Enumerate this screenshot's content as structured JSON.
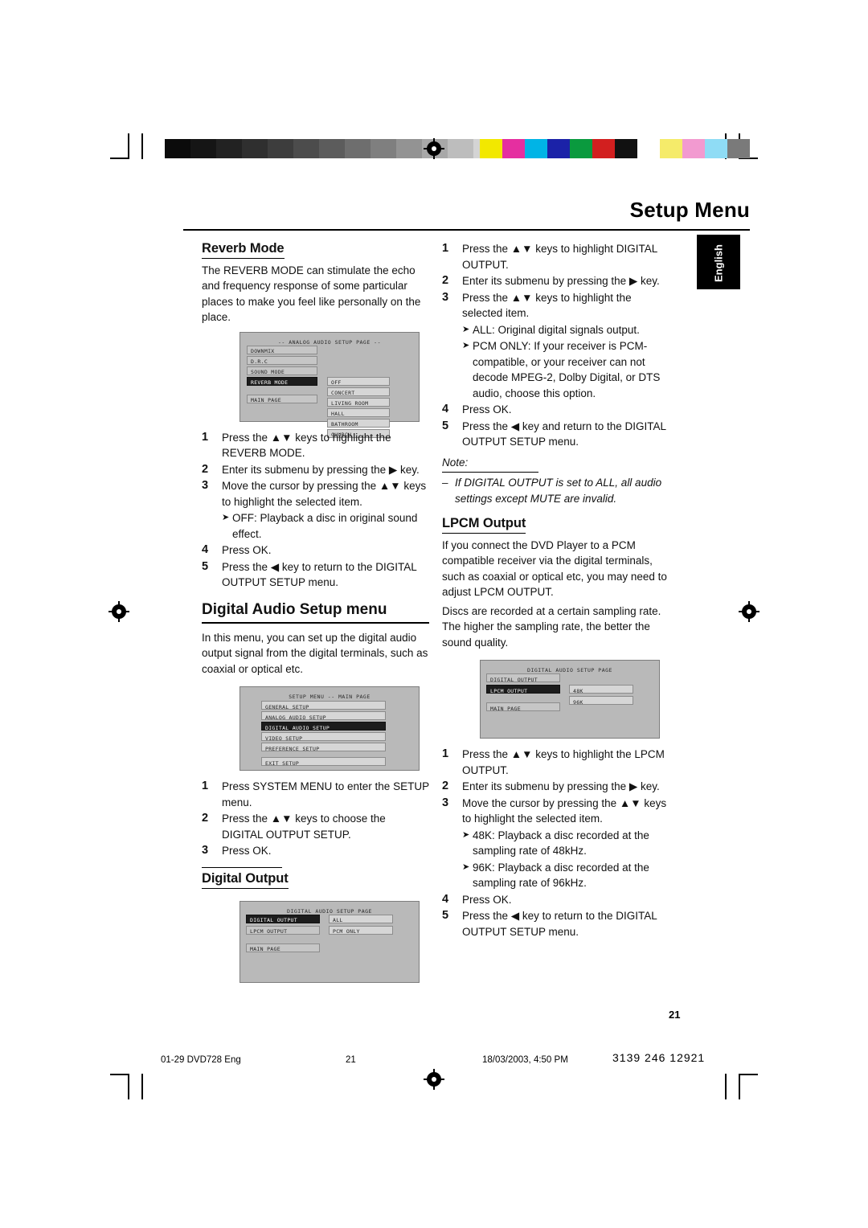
{
  "header": {
    "title": "Setup Menu",
    "language_tab": "English"
  },
  "print_marks": {
    "grayscale": [
      "#0b0b0b",
      "#151515",
      "#222222",
      "#2f2f2f",
      "#3d3d3d",
      "#4c4c4c",
      "#5c5c5c",
      "#6e6e6e",
      "#7f7f7f",
      "#939393",
      "#a8a8a8",
      "#bdbdbd",
      "#d4d4d4",
      "#ececec",
      "#ffffff"
    ],
    "colorbar": [
      "#f2e800",
      "#e52fa0",
      "#00b4e6",
      "#1b22a8",
      "#0a9a3e",
      "#d21f1f",
      "#111111",
      "#ffffff",
      "#f5eb6a",
      "#f29ad0",
      "#8fdcf5",
      "#7a7a7a"
    ]
  },
  "left_column": {
    "reverb": {
      "heading": "Reverb Mode",
      "paragraph": "The REVERB MODE can stimulate the echo and frequency response of some particular places to make you feel like personally on the place.",
      "osd": {
        "title": "-- ANALOG AUDIO SETUP PAGE --",
        "menu_items": [
          "DOWNMIX",
          "D.R.C",
          "SOUND MODE",
          "REVERB MODE",
          "MAIN PAGE"
        ],
        "selected_item": "REVERB MODE",
        "options": [
          "OFF",
          "CONCERT",
          "LIVING ROOM",
          "HALL",
          "BATHROOM",
          "CHURCH"
        ],
        "highlighted_option": "OFF"
      },
      "steps": [
        {
          "n": "1",
          "text": "Press the ▲▼ keys to highlight the REVERB MODE."
        },
        {
          "n": "2",
          "text": "Enter its submenu by pressing the ▶ key."
        },
        {
          "n": "3",
          "text": "Move the cursor by pressing the ▲▼ keys to highlight the selected item."
        }
      ],
      "bullet": "OFF: Playback a disc in original sound effect.",
      "steps2": [
        {
          "n": "4",
          "text": "Press OK."
        },
        {
          "n": "5",
          "text": "Press the ◀ key to return to the DIGITAL OUTPUT SETUP menu."
        }
      ]
    },
    "digital_audio_setup": {
      "heading": "Digital Audio Setup menu",
      "paragraph": "In this menu, you can set up the digital audio output signal from the digital terminals, such as coaxial or optical etc.",
      "osd": {
        "title": "SETUP MENU -- MAIN PAGE",
        "menu_items": [
          "GENERAL SETUP",
          "ANALOG AUDIO SETUP",
          "DIGITAL AUDIO SETUP",
          "VIDEO SETUP",
          "PREFERENCE SETUP",
          "EXIT SETUP"
        ],
        "selected_item": "DIGITAL AUDIO SETUP"
      },
      "steps": [
        {
          "n": "1",
          "text": "Press SYSTEM MENU to enter the SETUP menu."
        },
        {
          "n": "2",
          "text": "Press the ▲▼ keys to choose the DIGITAL OUTPUT SETUP."
        },
        {
          "n": "3",
          "text": "Press OK."
        }
      ]
    },
    "digital_output": {
      "heading": "Digital Output",
      "osd": {
        "title": "DIGITAL AUDIO SETUP PAGE",
        "menu_items": [
          "DIGITAL OUTPUT",
          "LPCM OUTPUT",
          "MAIN PAGE"
        ],
        "selected_item": "DIGITAL OUTPUT",
        "options": [
          "ALL",
          "PCM ONLY"
        ],
        "highlighted_option": "ALL"
      }
    }
  },
  "right_column": {
    "digital_output_steps": [
      {
        "n": "1",
        "text": "Press the ▲▼ keys to highlight DIGITAL OUTPUT."
      },
      {
        "n": "2",
        "text": "Enter its submenu by pressing the ▶ key."
      },
      {
        "n": "3",
        "text": "Press the ▲▼ keys to highlight the selected item."
      }
    ],
    "bullets": [
      "ALL: Original digital signals output.",
      "PCM ONLY: If your receiver is PCM-compatible, or your receiver can not decode MPEG-2, Dolby Digital, or DTS audio, choose this option."
    ],
    "digital_output_steps2": [
      {
        "n": "4",
        "text": "Press OK."
      },
      {
        "n": "5",
        "text": "Press the ◀ key and return to the DIGITAL OUTPUT SETUP menu."
      }
    ],
    "note": {
      "label": "Note:",
      "text": "If DIGITAL OUTPUT is set to ALL, all audio settings except MUTE are invalid."
    },
    "lpcm": {
      "heading": "LPCM Output",
      "paragraphs": [
        "If you connect the DVD Player to a PCM compatible receiver via the digital terminals, such as coaxial or optical etc, you may need to adjust LPCM OUTPUT.",
        "Discs are recorded at a certain sampling rate. The higher the sampling rate, the better the sound quality."
      ],
      "osd": {
        "title": "DIGITAL AUDIO SETUP PAGE",
        "menu_items": [
          "DIGITAL OUTPUT",
          "LPCM OUTPUT",
          "MAIN PAGE"
        ],
        "selected_item": "LPCM OUTPUT",
        "options": [
          "48K",
          "96K"
        ],
        "highlighted_option": "48K"
      },
      "steps": [
        {
          "n": "1",
          "text": "Press the ▲▼ keys to highlight the LPCM OUTPUT."
        },
        {
          "n": "2",
          "text": "Enter its submenu by pressing the ▶ key."
        },
        {
          "n": "3",
          "text": "Move the cursor by pressing the ▲▼ keys to highlight the selected item."
        }
      ],
      "bullets": [
        "48K: Playback a disc recorded at the sampling rate of 48kHz.",
        "96K: Playback a disc recorded at the sampling rate of 96kHz."
      ],
      "steps2": [
        {
          "n": "4",
          "text": "Press OK."
        },
        {
          "n": "5",
          "text": "Press the ◀ key to return to the DIGITAL OUTPUT SETUP menu."
        }
      ]
    }
  },
  "footer": {
    "page_number": "21",
    "file": "01-29 DVD728 Eng",
    "footer_page": "21",
    "timestamp": "18/03/2003, 4:50 PM",
    "code": "3139 246 12921"
  }
}
